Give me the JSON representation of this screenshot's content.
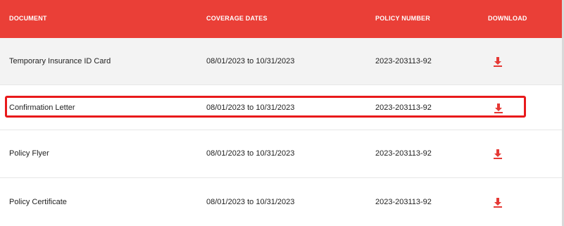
{
  "table": {
    "headers": {
      "document": "DOCUMENT",
      "coverage_dates": "COVERAGE DATES",
      "policy_number": "POLICY NUMBER",
      "download": "DOWNLOAD"
    },
    "rows": [
      {
        "document": "Temporary Insurance ID Card",
        "coverage": "08/01/2023 to 10/31/2023",
        "policy": "2023-203113-92",
        "download_icon": "download-icon"
      },
      {
        "document": "Confirmation Letter",
        "coverage": "08/01/2023 to 10/31/2023",
        "policy": "2023-203113-92",
        "download_icon": "download-icon"
      },
      {
        "document": "Policy Flyer",
        "coverage": "08/01/2023 to 10/31/2023",
        "policy": "2023-203113-92",
        "download_icon": "download-icon"
      },
      {
        "document": "Policy Certificate",
        "coverage": "08/01/2023 to 10/31/2023",
        "policy": "2023-203113-92",
        "download_icon": "download-icon"
      }
    ]
  },
  "colors": {
    "header_bg": "#ea3f37",
    "accent_red": "#e53935",
    "highlight_border": "#e8191b"
  }
}
